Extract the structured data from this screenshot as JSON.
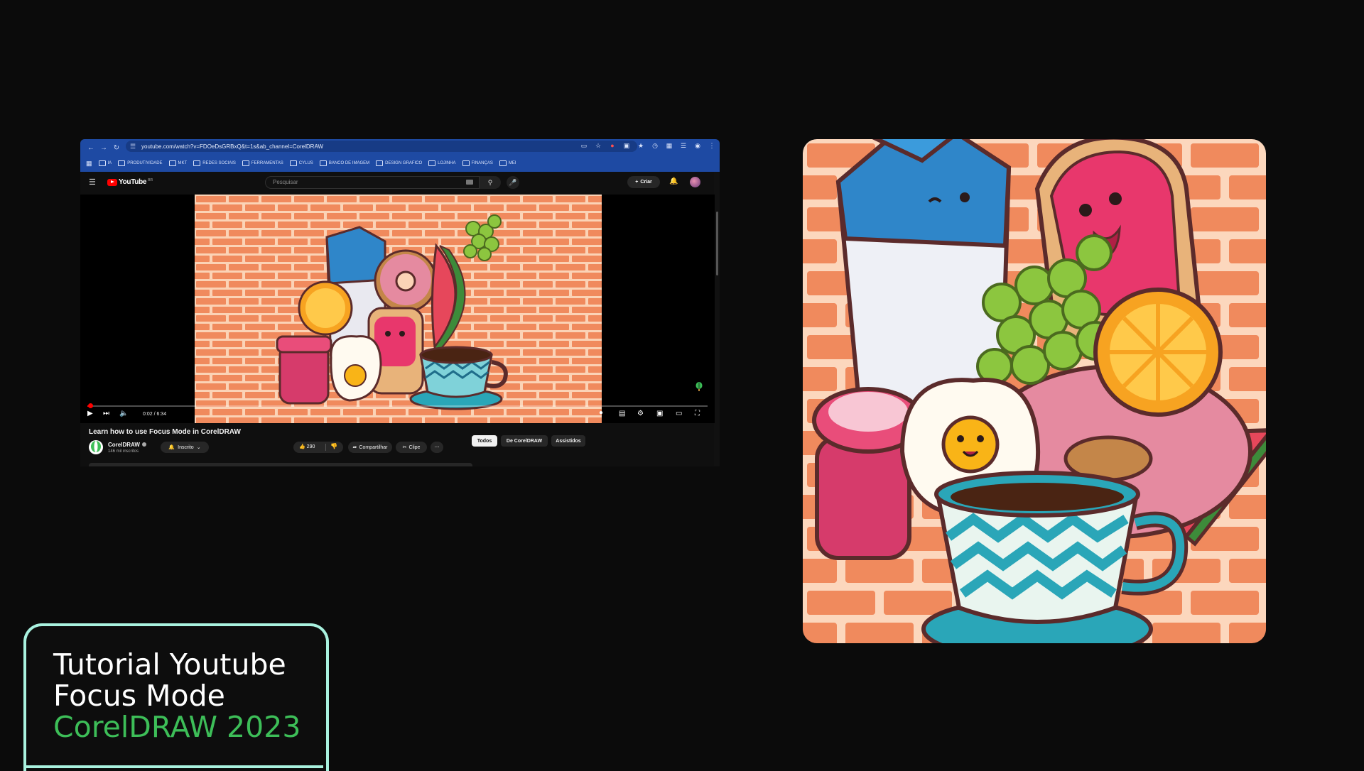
{
  "browser": {
    "url": "youtube.com/watch?v=FDOeDsGRBxQ&t=1s&ab_channel=CorelDRAW",
    "bookmarks": [
      "IA",
      "PRODUTIVIDADE",
      "MKT",
      "REDES SOCIAIS",
      "FERRAMENTAS",
      "CYLUS",
      "BANCO DE IMAGEM",
      "DESIGN GRAFICO",
      "LOJINHA",
      "FINANÇAS",
      "MEI"
    ]
  },
  "youtube": {
    "logo_text": "YouTube",
    "region": "BR",
    "search_placeholder": "Pesquisar",
    "create_label": "Criar",
    "video_title": "Learn how to use Focus Mode in CorelDRAW",
    "channel_name": "CorelDRAW",
    "subscribers": "146 mil inscritos",
    "subscribed_label": "Inscrito",
    "likes": "290",
    "share_label": "Compartilhar",
    "clip_label": "Clipe",
    "time": "0:02 / 6:34",
    "progress_fraction": 0.005,
    "chips": [
      "Todos",
      "De CorelDRAW",
      "Assistidos"
    ]
  },
  "title_card": {
    "line1": "Tutorial Youtube",
    "line2": "Focus Mode",
    "line3": "CorelDRAW 2023"
  },
  "colors": {
    "accent_green": "#3dbe58",
    "card_border": "#a9f2df",
    "browser_blue": "#1e4aa3",
    "brick": "#f08a5d",
    "mortar": "#fcd7bd"
  }
}
